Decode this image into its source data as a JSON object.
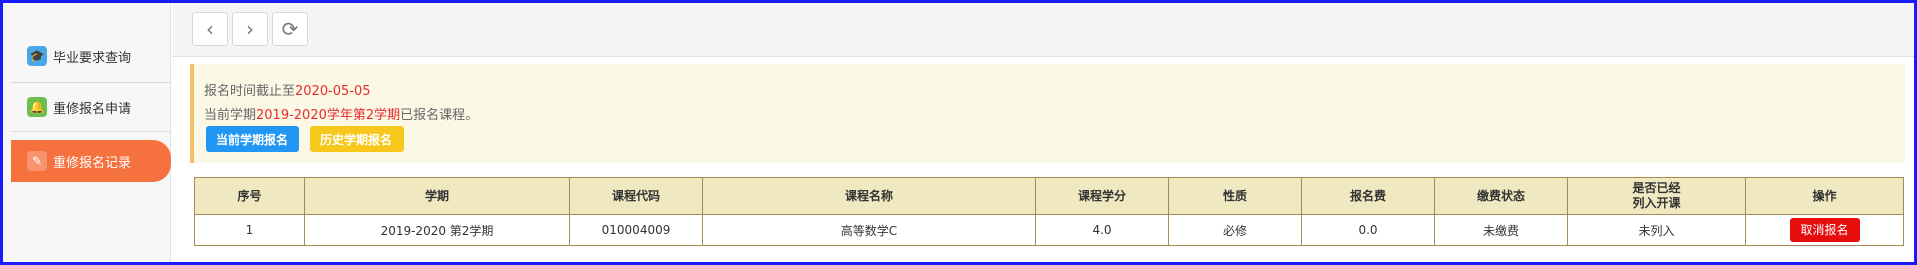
{
  "sidebar": {
    "items": [
      {
        "label": "毕业要求查询",
        "icon": "graduation-cap-icon"
      },
      {
        "label": "重修报名申请",
        "icon": "bell-icon"
      },
      {
        "label": "重修报名记录",
        "icon": "pencil-icon",
        "active": true
      }
    ]
  },
  "toolbar": {
    "back_icon": "‹",
    "forward_icon": "›",
    "refresh_icon": "⟳"
  },
  "notice": {
    "deadline_prefix": "报名时间截止至",
    "deadline_date": "2020-05-05",
    "term_prefix": "当前学期",
    "term_value": "2019-2020学年第2学期",
    "term_suffix": "已报名课程。",
    "current_term_button": "当前学期报名",
    "history_term_button": "历史学期报名"
  },
  "table": {
    "headers": [
      "序号",
      "学期",
      "课程代码",
      "课程名称",
      "课程学分",
      "性质",
      "报名费",
      "缴费状态",
      "是否已经\n列入开课",
      "操作"
    ],
    "rows": [
      {
        "seq": "1",
        "term": "2019-2020 第2学期",
        "course_code": "010004009",
        "course_name": "高等数学C",
        "credits": "4.0",
        "nature": "必修",
        "fee": "0.0",
        "payment_status": "未缴费",
        "scheduled": "未列入",
        "action": "取消报名"
      }
    ]
  },
  "colors": {
    "active_sidebar": "#f5713e",
    "accent_red": "#e62c2c",
    "blue_button": "#2196f3",
    "yellow_button": "#f7c81b",
    "table_header": "#efe8c1"
  }
}
